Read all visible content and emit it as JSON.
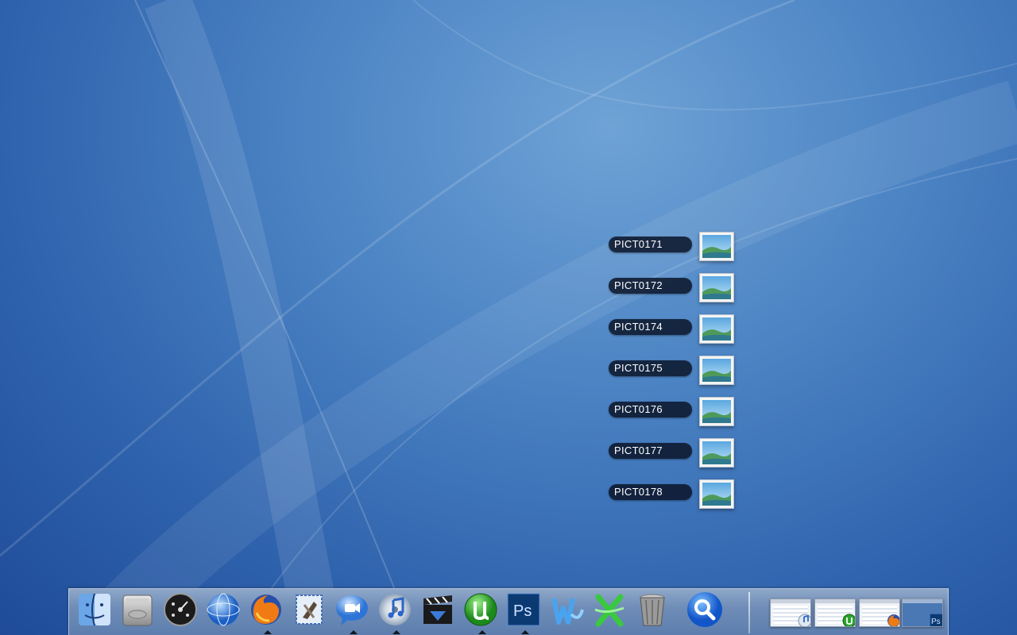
{
  "desktop": {
    "stack_items": [
      {
        "label": "PICT0171"
      },
      {
        "label": "PICT0172"
      },
      {
        "label": "PICT0174"
      },
      {
        "label": "PICT0175"
      },
      {
        "label": "PICT0176"
      },
      {
        "label": "PICT0177"
      },
      {
        "label": "PICT0178"
      }
    ]
  },
  "dock": {
    "apps": [
      {
        "name": "finder-icon",
        "running": false
      },
      {
        "name": "hard-drive-icon",
        "running": false
      },
      {
        "name": "dashboard-icon",
        "running": false
      },
      {
        "name": "network-globe-icon",
        "running": false
      },
      {
        "name": "firefox-icon",
        "running": true
      },
      {
        "name": "mail-icon",
        "running": false
      },
      {
        "name": "ichat-icon",
        "running": true
      },
      {
        "name": "itunes-icon",
        "running": true
      },
      {
        "name": "video-clapper-icon",
        "running": false
      },
      {
        "name": "utorrent-icon",
        "running": true
      },
      {
        "name": "photoshop-icon",
        "running": true,
        "text": "Ps"
      },
      {
        "name": "word-icon",
        "running": false
      },
      {
        "name": "excel-icon",
        "running": false
      },
      {
        "name": "trash-icon",
        "running": false
      },
      {
        "name": "search-icon",
        "running": false
      }
    ],
    "minimized": [
      {
        "badge": "itunes-icon"
      },
      {
        "badge": "utorrent-icon"
      },
      {
        "badge": "firefox-icon"
      },
      {
        "badge": "photoshop-icon",
        "text": "Ps"
      }
    ],
    "colors": {
      "accent": "#1f4b98",
      "dock": "#6f8db7"
    }
  }
}
